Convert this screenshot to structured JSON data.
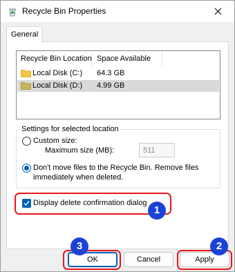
{
  "window": {
    "title": "Recycle Bin Properties",
    "icons": {
      "app": "recycle-bin-icon",
      "close": "close-icon"
    }
  },
  "tabs": [
    {
      "label": "General",
      "selected": true
    }
  ],
  "list": {
    "columns": [
      "Recycle Bin Location",
      "Space Available"
    ],
    "rows": [
      {
        "location": "Local Disk (C:)",
        "space": "64.3 GB",
        "selected": false
      },
      {
        "location": "Local Disk (D:)",
        "space": "4.99 GB",
        "selected": true
      }
    ]
  },
  "settings": {
    "legend": "Settings for selected location",
    "custom_size_label": "Custom size:",
    "max_size_label": "Maximum size (MB):",
    "max_size_value": "511",
    "dont_move_label_line1": "Don't move files to the Recycle Bin. Remove files",
    "dont_move_label_line2": "immediately when deleted.",
    "selected_option": "dont_move"
  },
  "confirm_checkbox": {
    "label": "Display delete confirmation dialog",
    "checked": true
  },
  "buttons": {
    "ok": "OK",
    "cancel": "Cancel",
    "apply": "Apply"
  },
  "annotations": {
    "badge1": "1",
    "badge2": "2",
    "badge3": "3"
  },
  "colors": {
    "accent": "#005fb8",
    "highlight": "#e8151b",
    "badge": "#1a43d6"
  }
}
